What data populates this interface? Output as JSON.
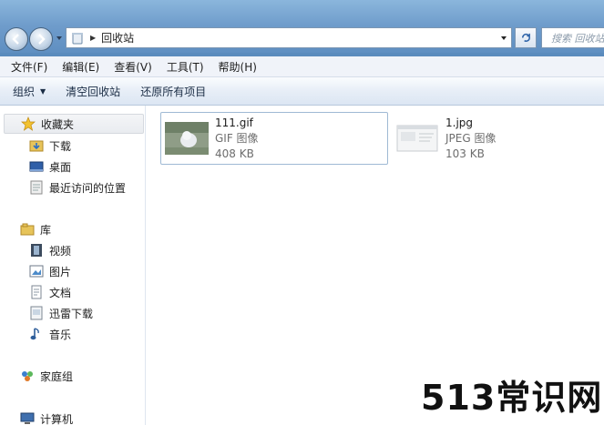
{
  "address": {
    "path_label": "回收站"
  },
  "search": {
    "placeholder": "搜索 回收站"
  },
  "menu": [
    "文件(F)",
    "编辑(E)",
    "查看(V)",
    "工具(T)",
    "帮助(H)"
  ],
  "commands": {
    "organize": "组织",
    "empty_bin": "清空回收站",
    "restore_all": "还原所有项目"
  },
  "sidebar": {
    "favorites": {
      "label": "收藏夹",
      "items": [
        "下载",
        "桌面",
        "最近访问的位置"
      ]
    },
    "libraries": {
      "label": "库",
      "items": [
        "视频",
        "图片",
        "文档",
        "迅雷下载",
        "音乐"
      ]
    },
    "homegroup": {
      "label": "家庭组"
    },
    "computer": {
      "label": "计算机"
    }
  },
  "files": [
    {
      "name": "111.gif",
      "type": "GIF 图像",
      "size": "408 KB",
      "selected": true
    },
    {
      "name": "1.jpg",
      "type": "JPEG 图像",
      "size": "103 KB",
      "selected": false
    }
  ],
  "watermark": "513常识网"
}
